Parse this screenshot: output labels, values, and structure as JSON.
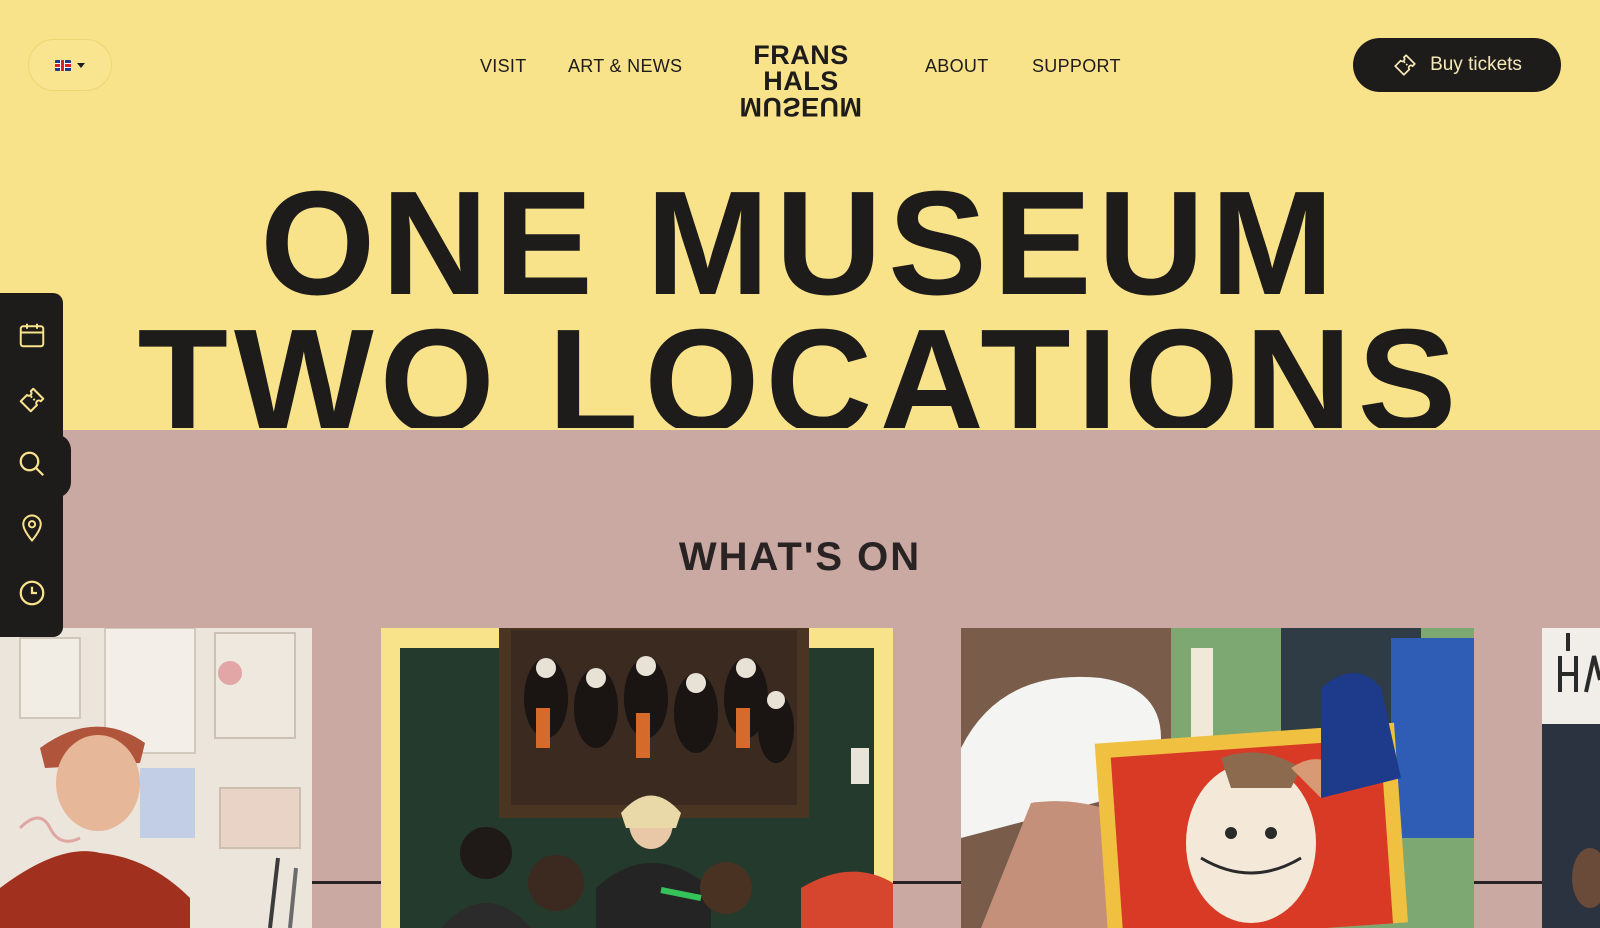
{
  "header": {
    "language": "EN",
    "nav": {
      "visit": "VISIT",
      "art_news": "ART & NEWS",
      "about": "ABOUT",
      "support": "SUPPORT"
    },
    "logo": {
      "top": "FRANS HALS",
      "bottom": "MUSEUM"
    },
    "buy_tickets": "Buy tickets"
  },
  "hero": {
    "line1": "ONE MUSEUM",
    "line2": "TWO LOCATIONS"
  },
  "whats_on": {
    "title": "WHAT'S ON"
  },
  "sidebar": {
    "items": [
      {
        "icon": "calendar-icon"
      },
      {
        "icon": "ticket-icon"
      },
      {
        "icon": "search-icon"
      },
      {
        "icon": "location-pin-icon"
      },
      {
        "icon": "clock-icon"
      }
    ]
  },
  "cards": [
    {
      "image": "man-in-cap-with-artworks"
    },
    {
      "image": "children-under-group-portrait-painting"
    },
    {
      "image": "child-painting-portrait"
    },
    {
      "image": "partial-card"
    }
  ],
  "colors": {
    "yellow": "#f8e38a",
    "pink": "#c9a9a2",
    "dark": "#1e1b1b"
  }
}
